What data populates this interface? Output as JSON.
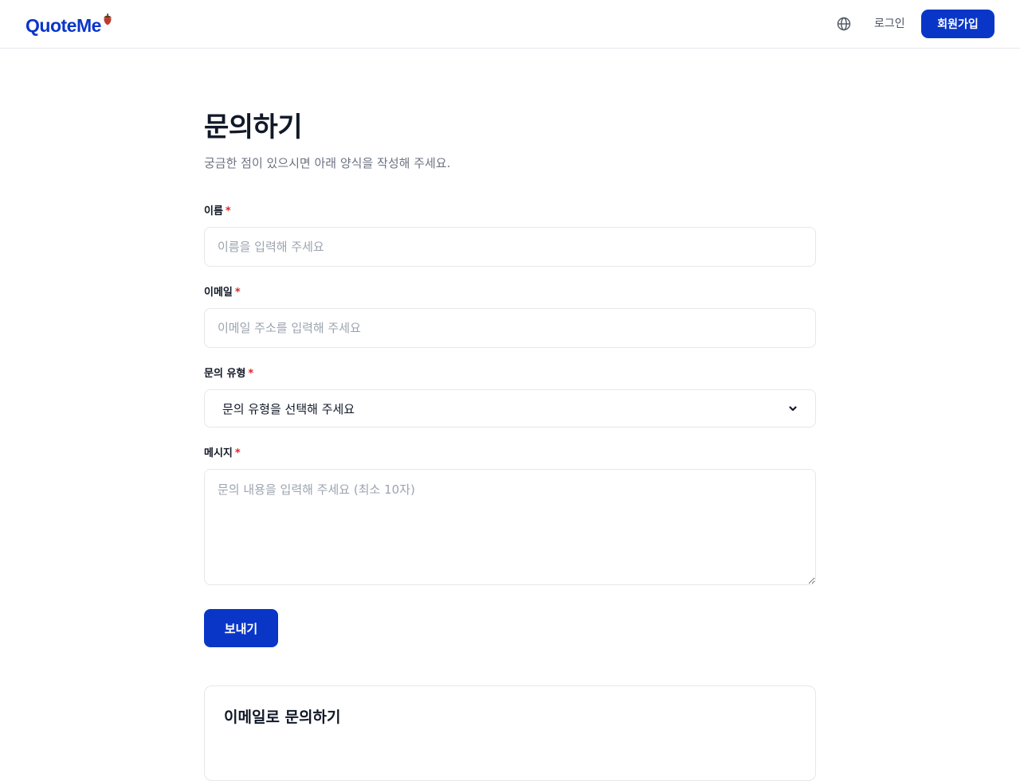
{
  "header": {
    "logo": "QuoteMe",
    "login": "로그인",
    "signup": "회원가입"
  },
  "page": {
    "title": "문의하기",
    "subtitle": "궁금한 점이 있으시면 아래 양식을 작성해 주세요."
  },
  "form": {
    "required_mark": "*",
    "name": {
      "label": "이름",
      "placeholder": "이름을 입력해 주세요"
    },
    "email": {
      "label": "이메일",
      "placeholder": "이메일 주소를 입력해 주세요"
    },
    "type": {
      "label": "문의 유형",
      "selected": "문의 유형을 선택해 주세요"
    },
    "message": {
      "label": "메시지",
      "placeholder": "문의 내용을 입력해 주세요 (최소 10자)"
    },
    "submit": "보내기"
  },
  "email_section": {
    "title": "이메일로 문의하기"
  },
  "icons": {
    "globe": "globe-icon",
    "chevron": "chevron-down-icon",
    "logo_mark": "acorn-icon"
  },
  "colors": {
    "brand": "#0a36c8",
    "required": "#dc2626",
    "border": "#e5e7eb",
    "muted": "#6b7280",
    "placeholder": "#9ca3af"
  }
}
